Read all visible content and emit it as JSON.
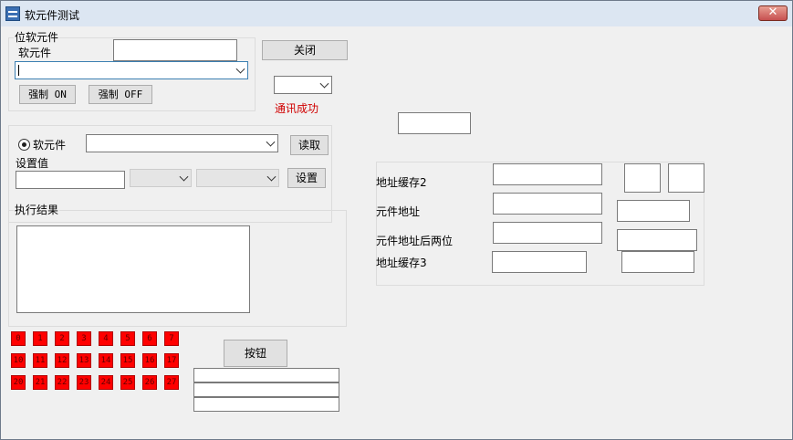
{
  "window": {
    "title": "软元件测试",
    "close_glyph": "✕"
  },
  "bit_group": {
    "legend": "位软元件",
    "device_label": "软元件",
    "device_input_value": "",
    "device_combo_value": "",
    "force_on_label": "强制 ON",
    "force_off_label": "强制 OFF"
  },
  "top": {
    "close_label": "关闭",
    "comm_combo_value": "",
    "comm_status": "通讯成功",
    "top_right_input_value": ""
  },
  "device_setting": {
    "radio_label": "软元件",
    "device_combo_value": "",
    "read_label": "读取",
    "set_value_label": "设置值",
    "set_value_input": "",
    "set_label": "设置"
  },
  "result_group": {
    "legend": "执行结果",
    "text": ""
  },
  "address_panel": {
    "addr_cache2_label": "地址缓存2",
    "element_addr_label": "元件地址",
    "element_addr_last2_label": "元件地址后两位",
    "addr_cache3_label": "地址缓存3"
  },
  "bits": {
    "row1": [
      "0",
      "1",
      "2",
      "3",
      "4",
      "5",
      "6",
      "7"
    ],
    "row2": [
      "10",
      "11",
      "12",
      "13",
      "14",
      "15",
      "16",
      "17"
    ],
    "row3": [
      "20",
      "21",
      "22",
      "23",
      "24",
      "25",
      "26",
      "27"
    ]
  },
  "button_label": "按钮",
  "colors": {
    "indicator_red": "#ff0000",
    "status_red": "#d00000"
  }
}
